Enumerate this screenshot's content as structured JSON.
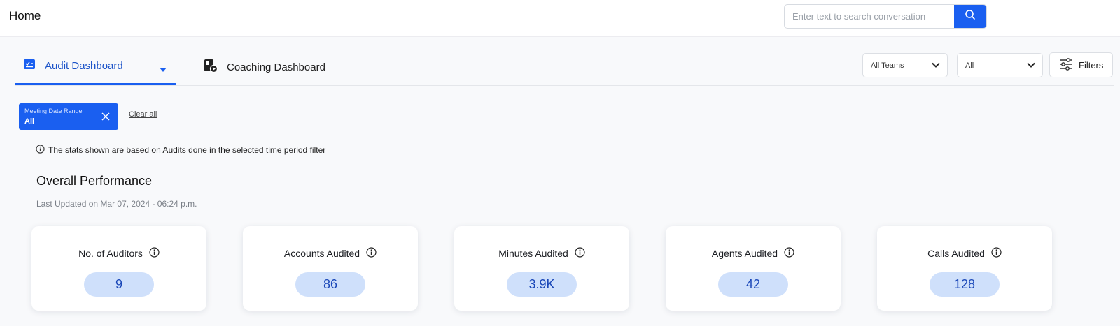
{
  "header": {
    "title": "Home",
    "search_placeholder": "Enter text to search conversation"
  },
  "tabs": [
    {
      "label": "Audit Dashboard",
      "active": true
    },
    {
      "label": "Coaching Dashboard",
      "active": false
    }
  ],
  "filters": {
    "team_select": "All Teams",
    "scope_select": "All",
    "filters_button": "Filters"
  },
  "active_filter": {
    "title": "Meeting Date Range",
    "value": "All",
    "clear_all": "Clear all"
  },
  "info_text": "The stats shown are based on Audits done in the selected time period filter",
  "overall": {
    "title": "Overall Performance",
    "last_updated": "Last Updated on Mar 07, 2024 - 06:24 p.m."
  },
  "stats": [
    {
      "label": "No. of Auditors",
      "value": "9"
    },
    {
      "label": "Accounts Audited",
      "value": "86"
    },
    {
      "label": "Minutes Audited",
      "value": "3.9K"
    },
    {
      "label": "Agents Audited",
      "value": "42"
    },
    {
      "label": "Calls Audited",
      "value": "128"
    }
  ],
  "colors": {
    "accent": "#1a5ff0",
    "pill_bg": "#cfe0fb",
    "pill_text": "#1a47b8"
  }
}
